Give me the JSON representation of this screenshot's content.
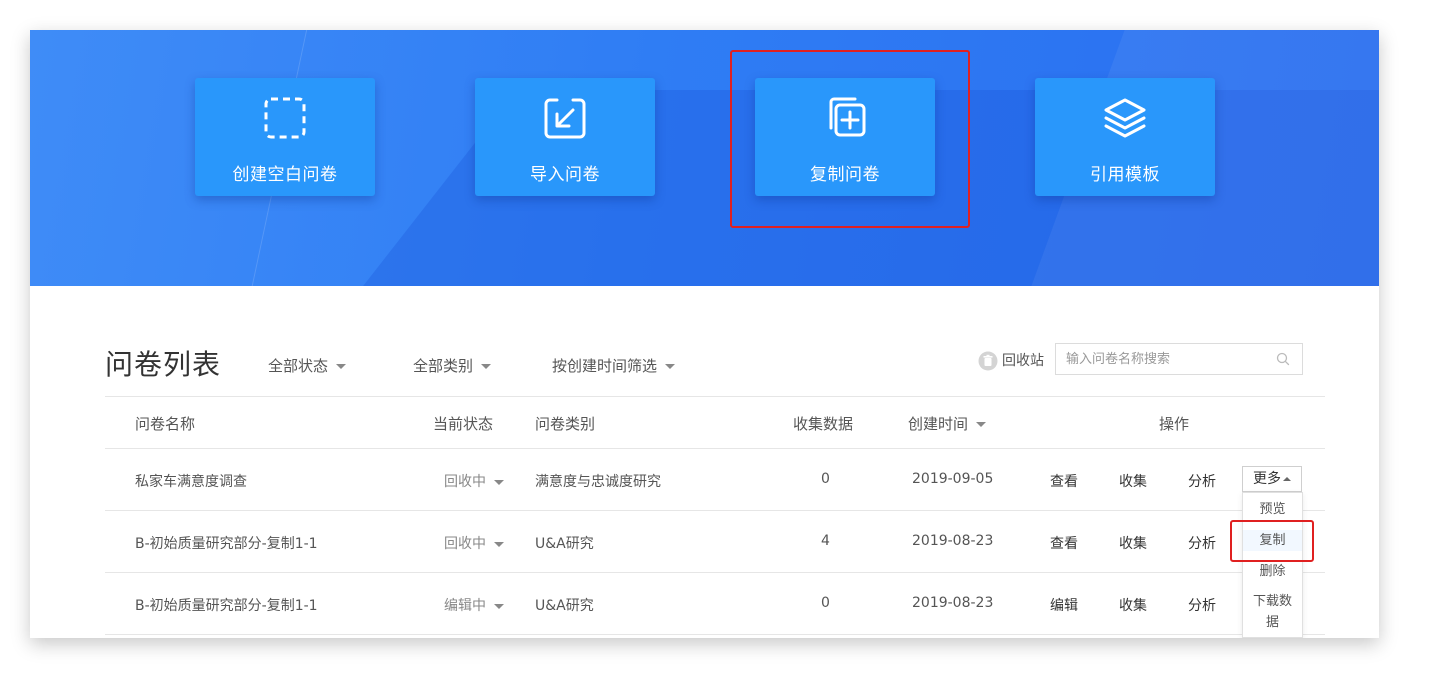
{
  "banner": {
    "cards": [
      {
        "label": "创建空白问卷",
        "icon": "dashed-square-icon"
      },
      {
        "label": "导入问卷",
        "icon": "import-arrow-icon"
      },
      {
        "label": "复制问卷",
        "icon": "copy-plus-icon",
        "highlighted": true
      },
      {
        "label": "引用模板",
        "icon": "layers-icon"
      }
    ]
  },
  "list": {
    "title": "问卷列表",
    "filters": {
      "status": "全部状态",
      "category": "全部类别",
      "time": "按创建时间筛选"
    },
    "recycle_bin": "回收站",
    "search_placeholder": "输入问卷名称搜索",
    "columns": {
      "name": "问卷名称",
      "status": "当前状态",
      "category": "问卷类别",
      "collected": "收集数据",
      "created": "创建时间",
      "ops": "操作"
    },
    "rows": [
      {
        "name": "私家车满意度调查",
        "status": "回收中",
        "category": "满意度与忠诚度研究",
        "collected": "0",
        "created": "2019-09-05",
        "op1": "查看",
        "op2": "收集",
        "op3": "分析"
      },
      {
        "name": "B-初始质量研究部分-复制1-1",
        "status": "回收中",
        "category": "U&A研究",
        "collected": "4",
        "created": "2019-08-23",
        "op1": "查看",
        "op2": "收集",
        "op3": "分析"
      },
      {
        "name": "B-初始质量研究部分-复制1-1",
        "status": "编辑中",
        "category": "U&A研究",
        "collected": "0",
        "created": "2019-08-23",
        "op1": "编辑",
        "op2": "收集",
        "op3": "分析"
      }
    ],
    "more_button": "更多",
    "more_menu": [
      "预览",
      "复制",
      "删除",
      "下载数",
      "据"
    ],
    "highlighted_menu_item": "复制"
  },
  "colors": {
    "banner": "#2f7df4",
    "card": "#2997fb",
    "highlight": "#e02020"
  }
}
